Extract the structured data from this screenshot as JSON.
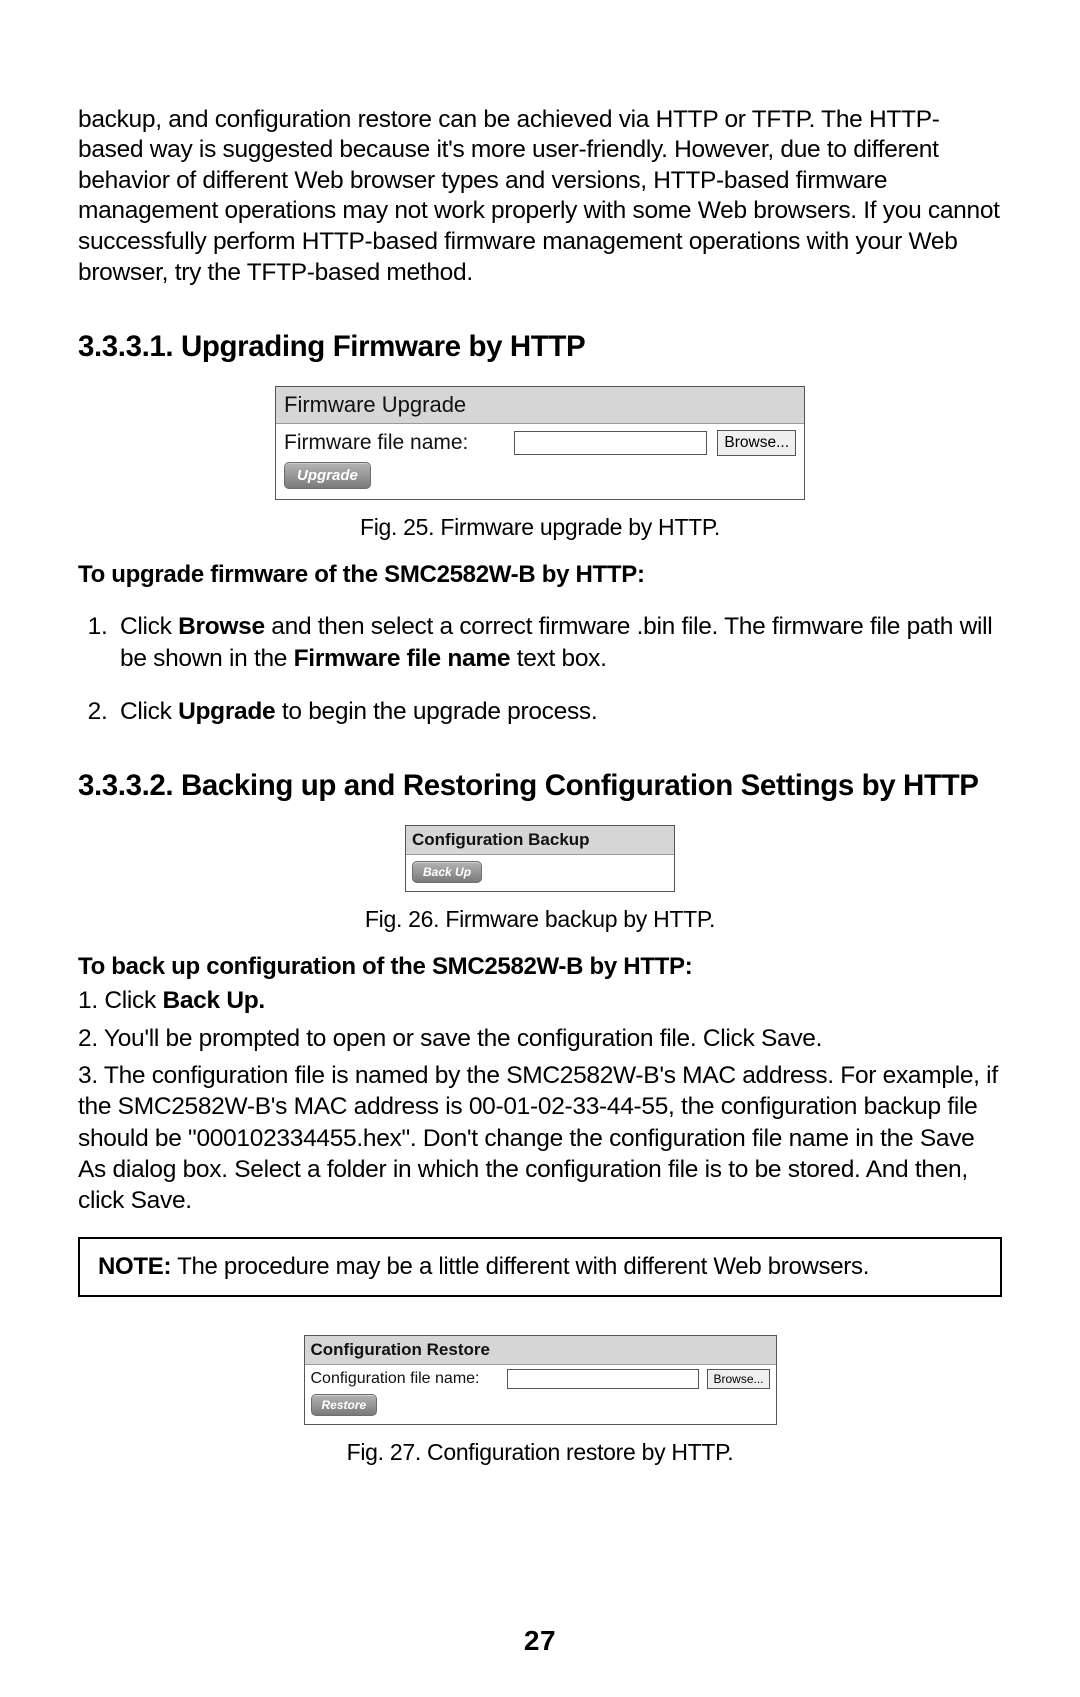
{
  "intro": "backup, and configuration restore can be achieved via HTTP or TFTP. The HTTP-based way is suggested because it's more user-friendly. However, due to different behavior of different Web browser types and versions, HTTP-based firmware management operations may not work properly with some Web browsers. If you cannot successfully perform HTTP-based firmware management operations with your Web browser, try the TFTP-based method.",
  "section1_heading": "3.3.3.1. Upgrading Firmware by HTTP",
  "fig25": {
    "panel_title": "Firmware Upgrade",
    "field_label": "Firmware file name:",
    "field_value": "",
    "browse_label": "Browse...",
    "upgrade_label": "Upgrade",
    "caption": "Fig. 25. Firmware upgrade by HTTP."
  },
  "upgrade_lead": "To upgrade firmware of the SMC2582W-B by HTTP:",
  "upgrade_steps": {
    "s1_a": "Click ",
    "s1_b": "Browse",
    "s1_c": " and then select a correct firmware .bin file. The firmware file path will be shown in the ",
    "s1_d": "Firmware file name",
    "s1_e": " text box.",
    "s2_a": "Click ",
    "s2_b": "Upgrade",
    "s2_c": " to begin the upgrade process."
  },
  "section2_heading": "3.3.3.2. Backing up and Restoring Configuration Settings by HTTP",
  "fig26": {
    "panel_title": "Configuration Backup",
    "backup_label": "Back Up",
    "caption": "Fig. 26. Firmware backup by HTTP."
  },
  "backup_lead": "To back up configuration of the SMC2582W-B by HTTP:",
  "backup_steps": {
    "l1_a": "1. Click ",
    "l1_b": "Back Up.",
    "l2": "2. You'll be prompted to open or save the configuration file. Click Save.",
    "l3": "3. The configuration file is named by the SMC2582W-B's MAC address. For example, if the SMC2582W-B's MAC address is 00-01-02-33-44-55, the configuration backup file should be \"000102334455.hex\". Don't change the configuration file name in the Save As dialog box. Select a folder in which the configuration file is to be stored. And then, click Save."
  },
  "note": {
    "label": "NOTE:",
    "text": " The procedure may be a little different with different Web browsers."
  },
  "fig27": {
    "panel_title": "Configuration Restore",
    "field_label": "Configuration file name:",
    "field_value": "",
    "browse_label": "Browse...",
    "restore_label": "Restore",
    "caption": "Fig. 27. Configuration restore by HTTP."
  },
  "page_number": "27"
}
